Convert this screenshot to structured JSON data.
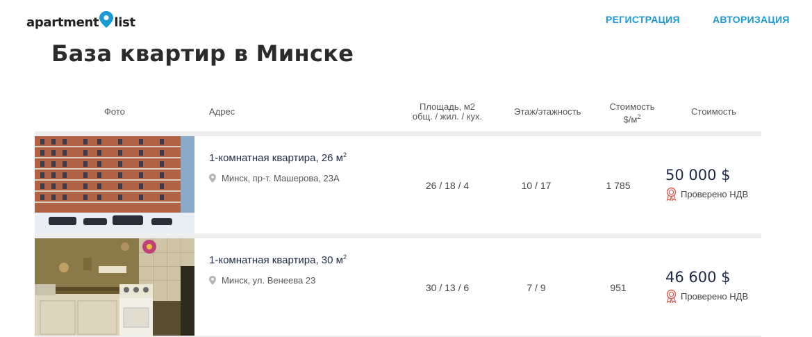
{
  "header": {
    "logo_left": "apartment",
    "logo_right": "list",
    "nav_register": "РЕГИСТРАЦИЯ",
    "nav_login": "АВТОРИЗАЦИЯ"
  },
  "page_title": "База квартир в Минске",
  "columns": {
    "photo": "Фото",
    "address": "Адрес",
    "area_line1": "Площадь, м2",
    "area_line2": "общ. / жил. / кух.",
    "floor": "Этаж/этажность",
    "ppm_line1": "Стоимость",
    "ppm_line2": "$/м",
    "ppm_sup": "2",
    "price": "Стоимость"
  },
  "listings": [
    {
      "title": "1-комнатная квартира, 26 м",
      "title_sup": "2",
      "address": "Минск, пр-т. Машерова, 23А",
      "area": "26 / 18 / 4",
      "floor": "10 / 17",
      "price_per_m2": "1 785",
      "price": "50 000 $",
      "verified": "Проверено НДВ"
    },
    {
      "title": "1-комнатная квартира, 30 м",
      "title_sup": "2",
      "address": "Минск, ул. Венеева 23",
      "area": "30 / 13 / 6",
      "floor": "7 / 9",
      "price_per_m2": "951",
      "price": "46 600 $",
      "verified": "Проверено НДВ"
    }
  ],
  "colors": {
    "nav": "#1a9ad6",
    "pin": "#1a9ad6",
    "badge": "#e05a4e",
    "price": "#1f2a44"
  }
}
